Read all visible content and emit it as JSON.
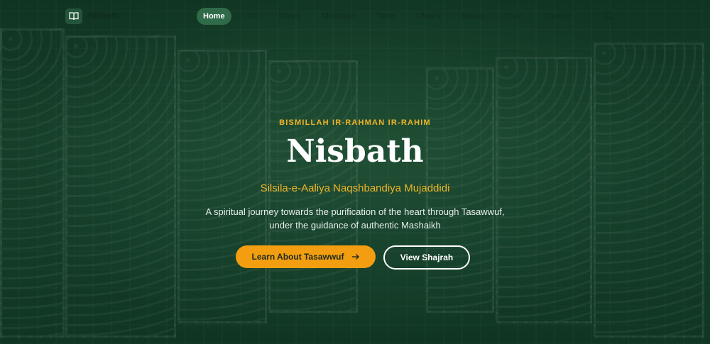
{
  "brand": {
    "name": "Nisbath",
    "logo_icon": "book-icon"
  },
  "nav": {
    "items": [
      {
        "label": "Home",
        "active": true
      },
      {
        "label": "Tar",
        "active": false
      },
      {
        "label": "Shajra",
        "active": false
      },
      {
        "label": "Mashaikh",
        "active": false
      },
      {
        "label": "Tafsir",
        "active": false
      },
      {
        "label": "Library",
        "active": false
      },
      {
        "label": "Media",
        "active": false
      },
      {
        "label": "Dhikr",
        "active": false
      },
      {
        "label": "Contact",
        "active": false
      }
    ],
    "search_icon": "search-icon"
  },
  "hero": {
    "eyebrow": "BISMILLAH IR-RAHMAN IR-RAHIM",
    "title": "Nisbath",
    "subtitle": "Silsila-e-Aaliya Naqshbandiya Mujaddidi",
    "description": "A spiritual journey towards the purification of the heart through Tasawwuf, under the guidance of authentic Mashaikh",
    "primary_button": {
      "label": "Learn About Tasawwuf",
      "icon": "arrow-right-icon"
    },
    "secondary_button": {
      "label": "View Shajrah"
    }
  },
  "colors": {
    "accent": "#f29e10",
    "gold_text": "#f0b429",
    "brand_green": "#2f6b49"
  }
}
